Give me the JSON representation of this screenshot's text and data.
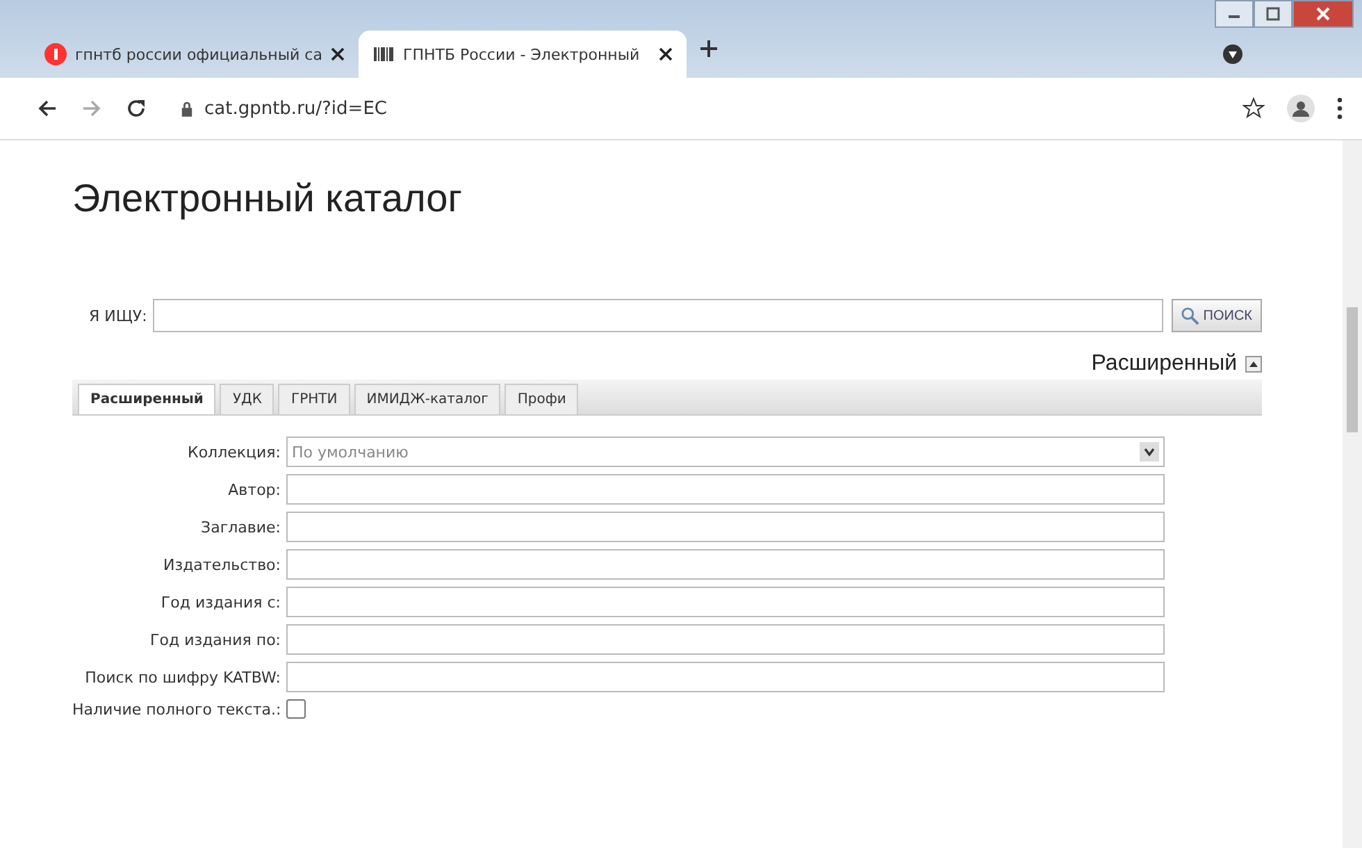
{
  "browser_tabs": [
    {
      "title": "гпнтб россии официальный са",
      "selected": false
    },
    {
      "title": "ГПНТБ России - Электронный",
      "selected": true
    }
  ],
  "address": "cat.gpntb.ru/?id=EC",
  "page_title": "Электронный каталог",
  "search": {
    "label": "Я ИЩУ:",
    "button": "ПОИСК"
  },
  "mode_toggle": "Расширенный",
  "tabs": [
    {
      "label": "Расширенный",
      "selected": true
    },
    {
      "label": "УДК",
      "selected": false
    },
    {
      "label": "ГРНТИ",
      "selected": false
    },
    {
      "label": "ИМИДЖ-каталог",
      "selected": false
    },
    {
      "label": "Профи",
      "selected": false
    }
  ],
  "fields": [
    {
      "kind": "select",
      "label": "Коллекция:",
      "value": "По умолчанию"
    },
    {
      "kind": "text",
      "label": "Автор:"
    },
    {
      "kind": "text",
      "label": "Заглавие:"
    },
    {
      "kind": "text",
      "label": "Издательство:"
    },
    {
      "kind": "text",
      "label": "Год издания с:"
    },
    {
      "kind": "text",
      "label": "Год издания по:"
    },
    {
      "kind": "text",
      "label": "Поиск по шифру KATBW:"
    },
    {
      "kind": "checkbox",
      "label": "Наличие полного текста.:",
      "checked": false
    }
  ]
}
